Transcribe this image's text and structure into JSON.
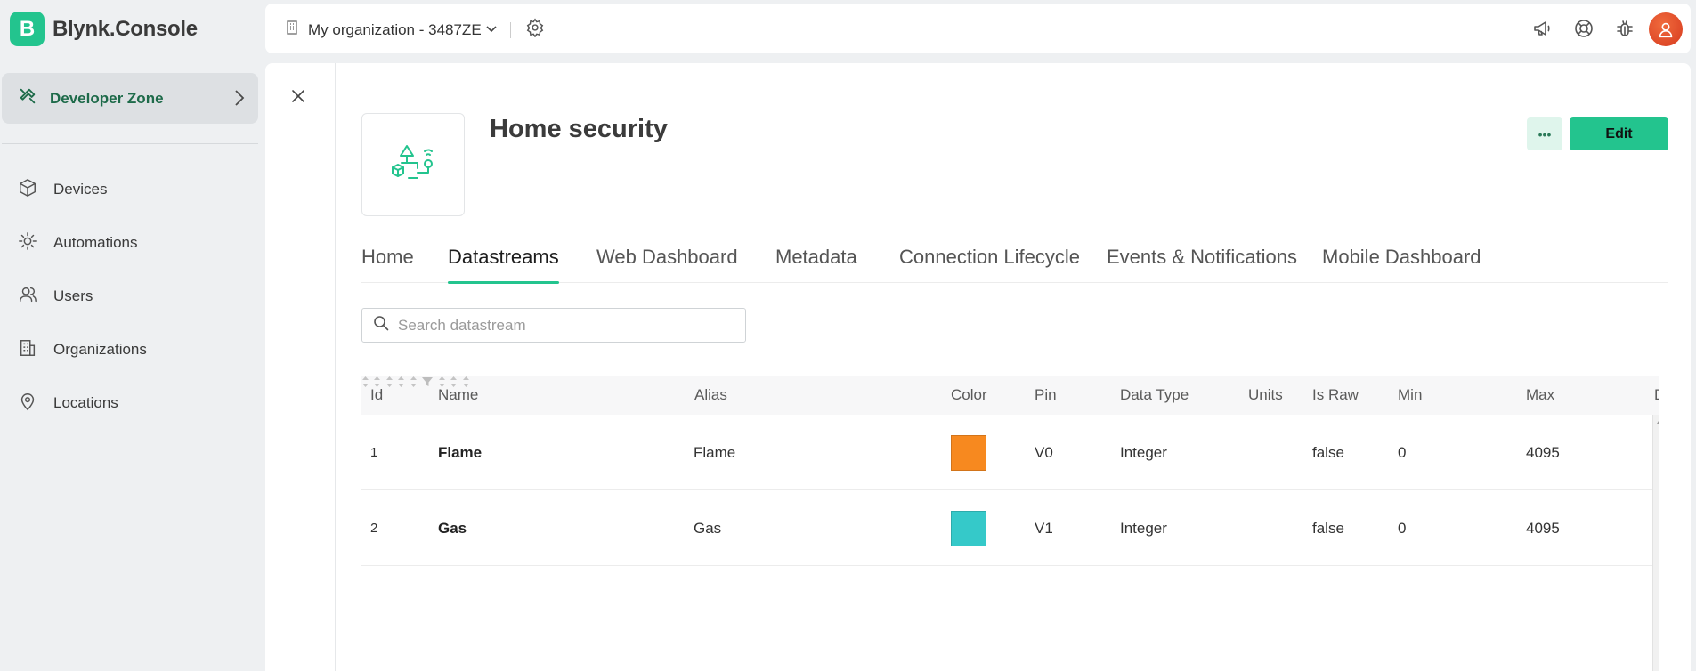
{
  "brand": {
    "logo_letter": "B",
    "name": "Blynk.Console"
  },
  "sidebar": {
    "developer_zone": "Developer Zone",
    "items": [
      {
        "label": "Devices",
        "icon": "cube-icon"
      },
      {
        "label": "Automations",
        "icon": "sun-icon"
      },
      {
        "label": "Users",
        "icon": "users-icon"
      },
      {
        "label": "Organizations",
        "icon": "building-icon"
      },
      {
        "label": "Locations",
        "icon": "location-pin-icon"
      }
    ]
  },
  "topbar": {
    "organization": "My organization - 3487ZE",
    "icons": [
      "megaphone-icon",
      "help-lifebuoy-icon",
      "bug-icon"
    ]
  },
  "template": {
    "title": "Home security",
    "edit_label": "Edit",
    "more_label": "•••"
  },
  "tabs": [
    {
      "label": "Home",
      "active": false
    },
    {
      "label": "Datastreams",
      "active": true
    },
    {
      "label": "Web Dashboard",
      "active": false
    },
    {
      "label": "Metadata",
      "active": false
    },
    {
      "label": "Connection Lifecycle",
      "active": false
    },
    {
      "label": "Events & Notifications",
      "active": false
    },
    {
      "label": "Mobile Dashboard",
      "active": false
    }
  ],
  "search": {
    "placeholder": "Search datastream",
    "value": ""
  },
  "table": {
    "columns": [
      "Id",
      "Name",
      "Alias",
      "Color",
      "Pin",
      "Data Type",
      "Units",
      "Is Raw",
      "Min",
      "Max",
      "De"
    ],
    "rows": [
      {
        "id": "1",
        "name": "Flame",
        "alias": "Flame",
        "color": "#f7891f",
        "pin": "V0",
        "data_type": "Integer",
        "units": "",
        "is_raw": "false",
        "min": "0",
        "max": "4095"
      },
      {
        "id": "2",
        "name": "Gas",
        "alias": "Gas",
        "color": "#35c9c9",
        "pin": "V1",
        "data_type": "Integer",
        "units": "",
        "is_raw": "false",
        "min": "0",
        "max": "4095"
      }
    ]
  },
  "colors": {
    "accent": "#23c48e",
    "developer_zone_text": "#1e6b4a"
  }
}
